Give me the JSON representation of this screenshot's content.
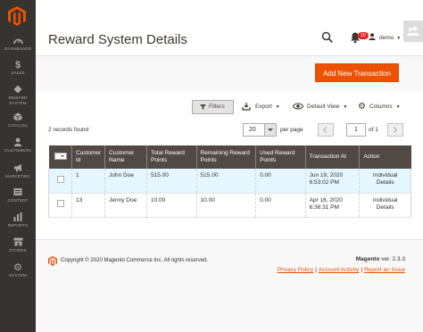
{
  "sidebar": {
    "items": [
      {
        "label": "DASHBOARD",
        "icon": "dashboard-icon"
      },
      {
        "label": "SALES",
        "icon": "dollar-icon"
      },
      {
        "label": "REWARD SYSTEM",
        "icon": "reward-icon"
      },
      {
        "label": "CATALOG",
        "icon": "cube-icon"
      },
      {
        "label": "CUSTOMERS",
        "icon": "person-icon"
      },
      {
        "label": "MARKETING",
        "icon": "megaphone-icon"
      },
      {
        "label": "CONTENT",
        "icon": "content-icon"
      },
      {
        "label": "REPORTS",
        "icon": "bar-chart-icon"
      },
      {
        "label": "STORES",
        "icon": "store-icon"
      },
      {
        "label": "SYSTEM",
        "icon": "gear-icon"
      }
    ]
  },
  "header": {
    "title": "Reward System Details",
    "notification_count": "10",
    "user": "demo"
  },
  "actions": {
    "add_label": "Add New Transaction"
  },
  "toolbar": {
    "filters": "Filters",
    "export": "Export",
    "view": "Default View",
    "columns": "Columns"
  },
  "grid": {
    "records_found": "2 records found",
    "per_page_value": "20",
    "per_page_label": "per page",
    "page": "1",
    "of_pages": "of 1",
    "columns": [
      "Customer Id",
      "Customer Name",
      "Total Reward Points",
      "Remaining Reward Points",
      "Used Reward Points",
      "Transaction At",
      "Action"
    ],
    "rows": [
      {
        "id": "1",
        "name": "John Doe",
        "total": "515.00",
        "remaining": "515.00",
        "used": "0.00",
        "at": "Jun 19, 2020 6:53:02 PM",
        "action": "Individual Details"
      },
      {
        "id": "13",
        "name": "Jenny Doe",
        "total": "10.00",
        "remaining": "10.00",
        "used": "0.00",
        "at": "Apr 16, 2020 6:36:31 PM",
        "action": "Individual Details"
      }
    ]
  },
  "footer": {
    "copyright": "Copyright © 2020 Magento Commerce Inc. All rights reserved.",
    "brand": "Magento",
    "version": "ver. 2.3.3",
    "links": [
      "Privacy Policy",
      "Account Activity",
      "Report an Issue"
    ]
  },
  "colors": {
    "accent": "#eb5202",
    "sidebar": "#373330",
    "grid_header": "#514943",
    "link": "#007bdb"
  }
}
